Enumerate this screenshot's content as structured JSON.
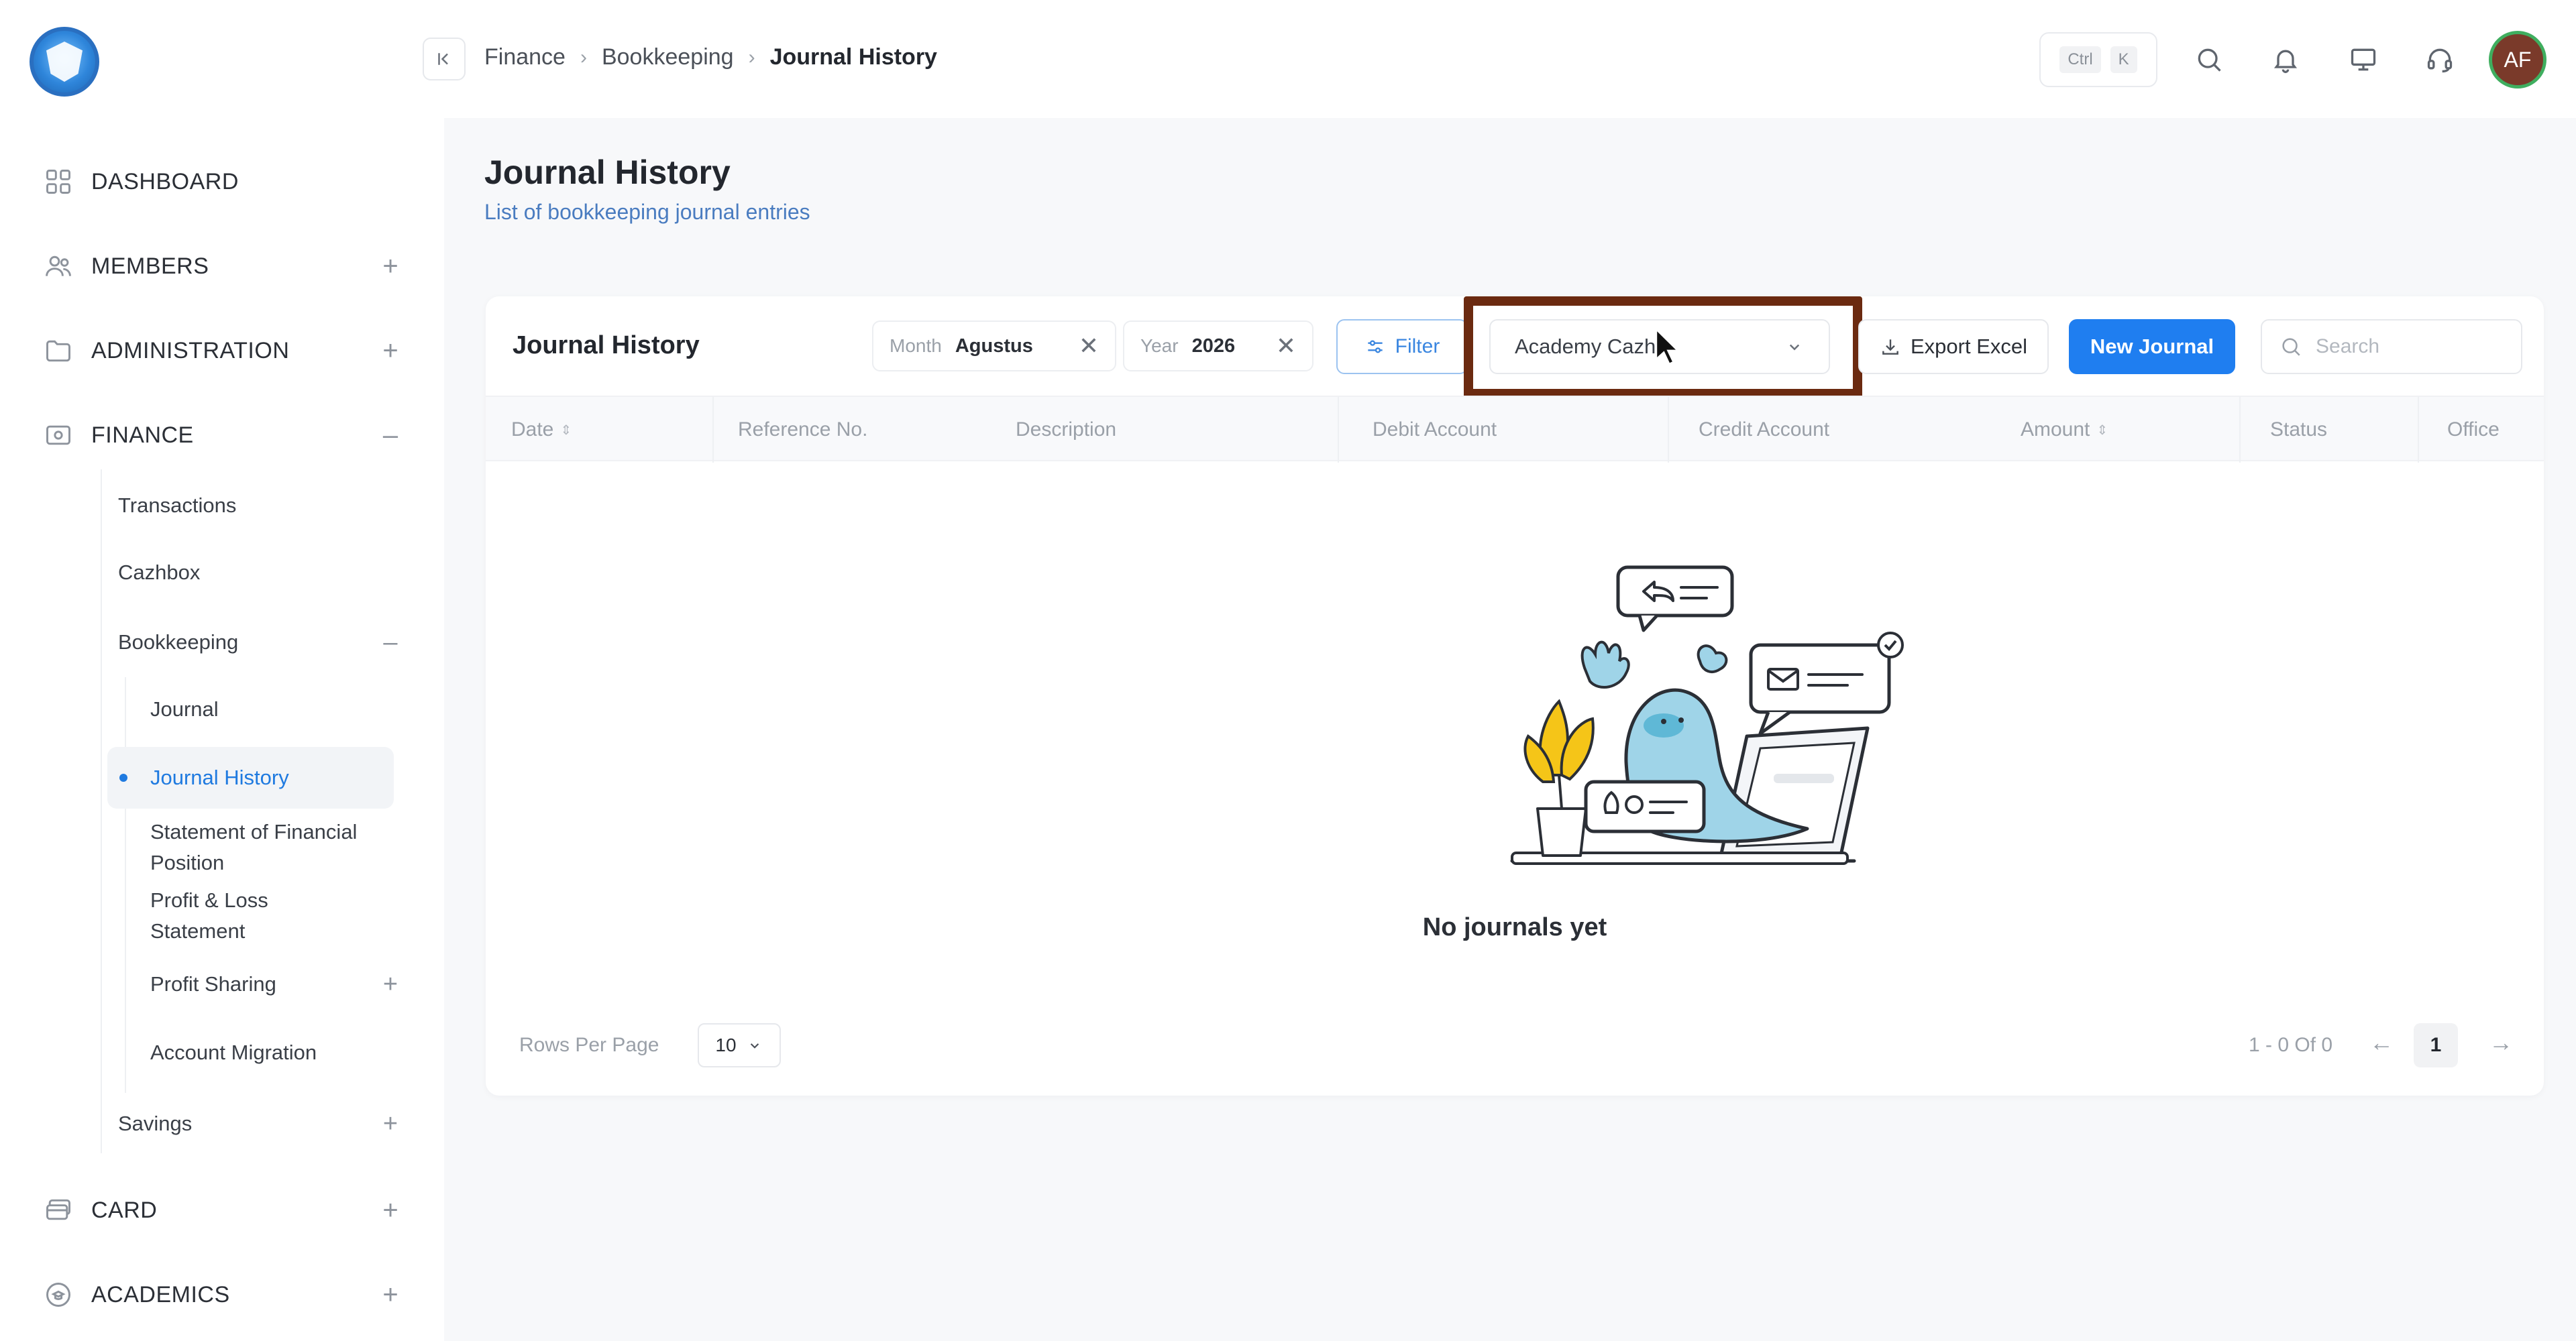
{
  "sidebar": {
    "sections": [
      {
        "label": "DASHBOARD",
        "icon": "grid-icon",
        "toggle": ""
      },
      {
        "label": "MEMBERS",
        "icon": "users-icon",
        "toggle": "+"
      },
      {
        "label": "ADMINISTRATION",
        "icon": "folder-icon",
        "toggle": "+"
      },
      {
        "label": "FINANCE",
        "icon": "wallet-icon",
        "toggle": "–"
      },
      {
        "label": "CARD",
        "icon": "card-icon",
        "toggle": "+"
      },
      {
        "label": "ACADEMICS",
        "icon": "academic-icon",
        "toggle": "+"
      }
    ],
    "finance_items": [
      {
        "label": "Transactions",
        "toggle": ""
      },
      {
        "label": "Cazhbox",
        "toggle": ""
      },
      {
        "label": "Bookkeeping",
        "toggle": "–"
      },
      {
        "label": "Savings",
        "toggle": "+"
      }
    ],
    "bookkeeping_items": [
      {
        "label": "Journal",
        "toggle": ""
      },
      {
        "label": "Journal History",
        "toggle": "",
        "active": true
      },
      {
        "label": "Statement of Financial Position",
        "toggle": ""
      },
      {
        "label": "Profit & Loss Statement",
        "toggle": ""
      },
      {
        "label": "Profit Sharing",
        "toggle": "+"
      },
      {
        "label": "Account Migration",
        "toggle": ""
      }
    ]
  },
  "topbar": {
    "breadcrumb": [
      "Finance",
      "Bookkeeping",
      "Journal History"
    ],
    "shortcut": {
      "key1": "Ctrl",
      "key2": "K"
    },
    "icons": [
      "search-icon",
      "bell-icon",
      "monitor-icon",
      "headset-icon"
    ],
    "avatar_initials": "AF"
  },
  "page": {
    "title": "Journal History",
    "subtitle": "List of bookkeeping journal entries"
  },
  "card": {
    "title": "Journal History",
    "month_chip": {
      "key": "Month",
      "value": "Agustus",
      "clear": "✕"
    },
    "year_chip": {
      "key": "Year",
      "value": "2026",
      "clear": "✕"
    },
    "filter_label": "Filter",
    "office_select_value": "Academy Cazh",
    "export_label": "Export Excel",
    "new_label": "New Journal",
    "search_placeholder": "Search",
    "columns": [
      "Date",
      "Reference No.",
      "Description",
      "Debit Account",
      "Credit Account",
      "Amount",
      "Status",
      "Office"
    ],
    "empty_message": "No journals yet",
    "rows_per_page_label": "Rows Per Page",
    "rows_per_page_value": "10",
    "pager_info": "1 - 0 Of 0",
    "current_page": "1",
    "prev_arrow": "←",
    "next_arrow": "→"
  },
  "colors": {
    "primary": "#1f7ef0",
    "highlight": "#6b2a10",
    "avatar_bg": "#7a3a2a",
    "avatar_ring": "#3fae5f"
  }
}
